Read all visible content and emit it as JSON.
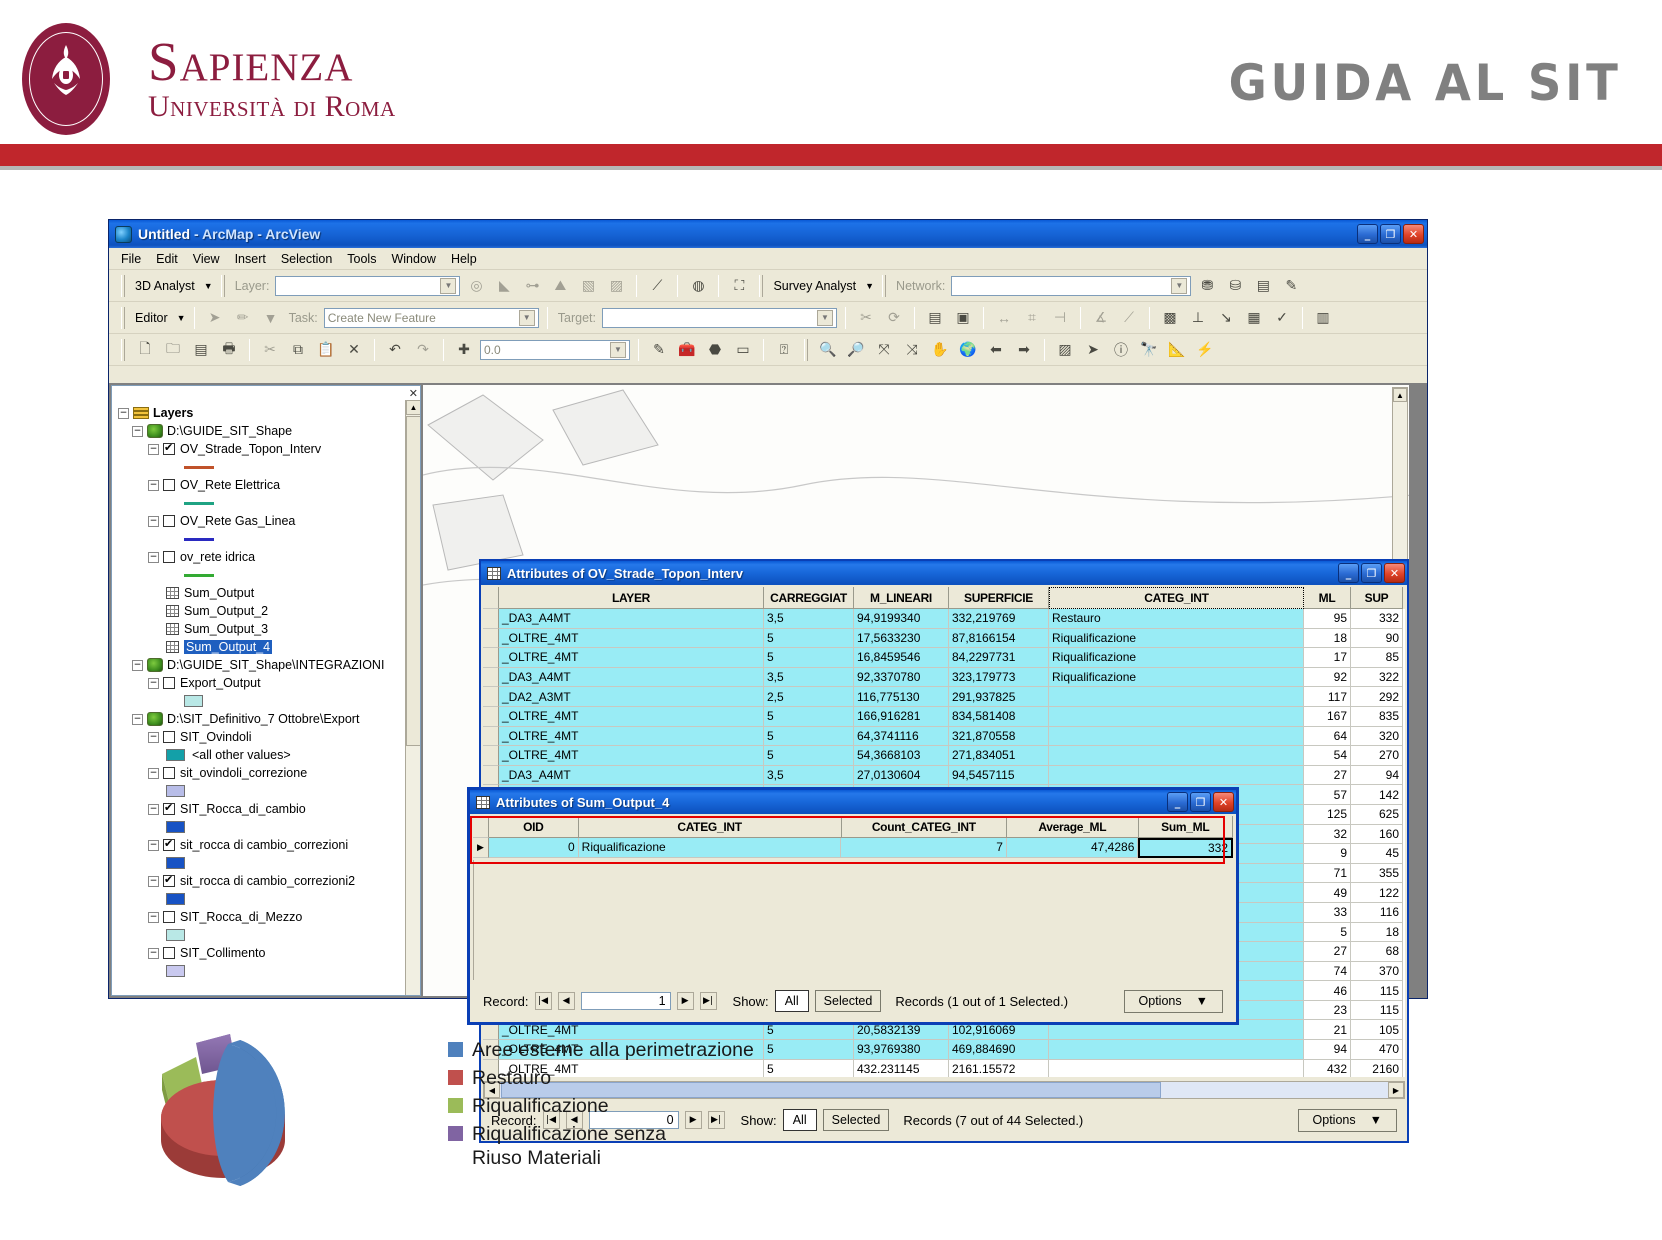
{
  "header": {
    "university_line1": "Sapienza",
    "university_line2": "Università di Roma",
    "title": "GUIDA AL SIT",
    "brand_color": "#8c1d3f",
    "bar_color": "#c0262c"
  },
  "arcmap": {
    "title": "Untitled",
    "title_suffix": " - ArcMap - ArcView",
    "window_buttons": {
      "minimize": "_",
      "maximize": "❐",
      "close": "✕"
    },
    "menu": [
      "File",
      "Edit",
      "View",
      "Insert",
      "Selection",
      "Tools",
      "Window",
      "Help"
    ],
    "toolbar_3d": {
      "dropdown_label": "3D Analyst",
      "layer_label": "Layer:",
      "layer_value": ""
    },
    "toolbar_survey": {
      "dropdown_label": "Survey Analyst",
      "network_label": "Network:",
      "network_value": ""
    },
    "toolbar_editor": {
      "dropdown_label": "Editor",
      "task_label": "Task:",
      "task_value": "Create New Feature",
      "target_label": "Target:",
      "target_value": ""
    },
    "toolbar_standard": {
      "scale_value": "0.0"
    }
  },
  "toc": {
    "root_label": "Layers",
    "groups": [
      {
        "path": "D:\\GUIDE_SIT_Shape",
        "layers": [
          {
            "name": "OV_Strade_Topon_Interv",
            "checked": true,
            "symbol_type": "line",
            "color": "#c0522a"
          },
          {
            "name": "OV_Rete Elettrica",
            "checked": false,
            "symbol_type": "line",
            "color": "#1fa383"
          },
          {
            "name": "OV_Rete Gas_Linea",
            "checked": false,
            "symbol_type": "line",
            "color": "#2a2ac0"
          },
          {
            "name": "ov_rete idrica",
            "checked": false,
            "symbol_type": "line",
            "color": "#33aa33"
          }
        ],
        "tables": [
          "Sum_Output",
          "Sum_Output_2",
          "Sum_Output_3",
          "Sum_Output_4"
        ],
        "selected_table": "Sum_Output_4"
      },
      {
        "path": "D:\\GUIDE_SIT_Shape\\INTEGRAZIONI",
        "layers": [
          {
            "name": "Export_Output",
            "checked": false,
            "symbol_type": "box",
            "color": "#b9e8e6"
          }
        ],
        "tables": [],
        "selected_table": null
      },
      {
        "path": "D:\\SIT_Definitivo_7 Ottobre\\Export",
        "layers": [
          {
            "name": "SIT_Ovindoli",
            "checked": false,
            "symbol_type": "box",
            "color": "#13a0a8",
            "sub_label": "<all other values>"
          },
          {
            "name": "sit_ovindoli_correzione",
            "checked": false,
            "symbol_type": "box",
            "color": "#b8bde8"
          },
          {
            "name": "SIT_Rocca_di_cambio",
            "checked": true,
            "symbol_type": "box",
            "color": "#1752c4"
          },
          {
            "name": "sit_rocca di cambio_correzioni",
            "checked": true,
            "symbol_type": "box",
            "color": "#1752c4"
          },
          {
            "name": "sit_rocca di cambio_correzioni2",
            "checked": true,
            "symbol_type": "box",
            "color": "#1752c4"
          },
          {
            "name": "SIT_Rocca_di_Mezzo",
            "checked": false,
            "symbol_type": "box",
            "color": "#b9e8e6"
          },
          {
            "name": "SIT_Collimento",
            "checked": false,
            "symbol_type": "box",
            "color": "#c9c9ef"
          }
        ],
        "tables": [],
        "selected_table": null
      }
    ]
  },
  "attr_table": {
    "title": "Attributes of OV_Strade_Topon_Interv",
    "columns": [
      "LAYER",
      "CARREGGIAT",
      "M_LINEARI",
      "SUPERFICIE",
      "CATEG_INT",
      "ML",
      "SUP"
    ],
    "focused_column": "CATEG_INT",
    "rows": [
      {
        "LAYER": "_DA3_A4MT",
        "CARREGGIAT": "3,5",
        "M_LINEARI": "94,9199340",
        "SUPERFICIE": "332,219769",
        "CATEG_INT": "Restauro",
        "ML": "95",
        "SUP": "332",
        "selected": true
      },
      {
        "LAYER": "_OLTRE_4MT",
        "CARREGGIAT": "5",
        "M_LINEARI": "17,5633230",
        "SUPERFICIE": "87,8166154",
        "CATEG_INT": "Riqualificazione",
        "ML": "18",
        "SUP": "90",
        "selected": true
      },
      {
        "LAYER": "_OLTRE_4MT",
        "CARREGGIAT": "5",
        "M_LINEARI": "16,8459546",
        "SUPERFICIE": "84,2297731",
        "CATEG_INT": "Riqualificazione",
        "ML": "17",
        "SUP": "85",
        "selected": true
      },
      {
        "LAYER": "_DA3_A4MT",
        "CARREGGIAT": "3,5",
        "M_LINEARI": "92,3370780",
        "SUPERFICIE": "323,179773",
        "CATEG_INT": "Riqualificazione",
        "ML": "92",
        "SUP": "322",
        "selected": true
      },
      {
        "LAYER": "_DA2_A3MT",
        "CARREGGIAT": "2,5",
        "M_LINEARI": "116,775130",
        "SUPERFICIE": "291,937825",
        "CATEG_INT": "",
        "ML": "117",
        "SUP": "292",
        "selected": true
      },
      {
        "LAYER": "_OLTRE_4MT",
        "CARREGGIAT": "5",
        "M_LINEARI": "166,916281",
        "SUPERFICIE": "834,581408",
        "CATEG_INT": "",
        "ML": "167",
        "SUP": "835",
        "selected": true
      },
      {
        "LAYER": "_OLTRE_4MT",
        "CARREGGIAT": "5",
        "M_LINEARI": "64,3741116",
        "SUPERFICIE": "321,870558",
        "CATEG_INT": "",
        "ML": "64",
        "SUP": "320",
        "selected": true
      },
      {
        "LAYER": "_OLTRE_4MT",
        "CARREGGIAT": "5",
        "M_LINEARI": "54,3668103",
        "SUPERFICIE": "271,834051",
        "CATEG_INT": "",
        "ML": "54",
        "SUP": "270",
        "selected": true
      },
      {
        "LAYER": "_DA3_A4MT",
        "CARREGGIAT": "3,5",
        "M_LINEARI": "27,0130604",
        "SUPERFICIE": "94,5457115",
        "CATEG_INT": "",
        "ML": "27",
        "SUP": "94",
        "selected": true
      },
      {
        "LAYER": "",
        "CARREGGIAT": "",
        "M_LINEARI": "",
        "SUPERFICIE": "",
        "CATEG_INT": "",
        "ML": "57",
        "SUP": "142",
        "selected": true
      },
      {
        "LAYER": "",
        "CARREGGIAT": "",
        "M_LINEARI": "",
        "SUPERFICIE": "",
        "CATEG_INT": "",
        "ML": "125",
        "SUP": "625",
        "selected": true
      },
      {
        "LAYER": "",
        "CARREGGIAT": "",
        "M_LINEARI": "",
        "SUPERFICIE": "",
        "CATEG_INT": "",
        "ML": "32",
        "SUP": "160",
        "selected": true
      },
      {
        "LAYER": "",
        "CARREGGIAT": "",
        "M_LINEARI": "",
        "SUPERFICIE": "",
        "CATEG_INT": "",
        "ML": "9",
        "SUP": "45",
        "selected": true
      },
      {
        "LAYER": "",
        "CARREGGIAT": "",
        "M_LINEARI": "",
        "SUPERFICIE": "",
        "CATEG_INT": "",
        "ML": "71",
        "SUP": "355",
        "selected": true
      },
      {
        "LAYER": "",
        "CARREGGIAT": "",
        "M_LINEARI": "",
        "SUPERFICIE": "",
        "CATEG_INT": "",
        "ML": "49",
        "SUP": "122",
        "selected": true
      },
      {
        "LAYER": "",
        "CARREGGIAT": "",
        "M_LINEARI": "",
        "SUPERFICIE": "",
        "CATEG_INT": "",
        "ML": "33",
        "SUP": "116",
        "selected": true
      },
      {
        "LAYER": "",
        "CARREGGIAT": "",
        "M_LINEARI": "",
        "SUPERFICIE": "",
        "CATEG_INT": "",
        "ML": "5",
        "SUP": "18",
        "selected": true
      },
      {
        "LAYER": "",
        "CARREGGIAT": "",
        "M_LINEARI": "",
        "SUPERFICIE": "",
        "CATEG_INT": "",
        "ML": "27",
        "SUP": "68",
        "selected": true
      },
      {
        "LAYER": "",
        "CARREGGIAT": "",
        "M_LINEARI": "",
        "SUPERFICIE": "",
        "CATEG_INT": "",
        "ML": "74",
        "SUP": "370",
        "selected": true
      },
      {
        "LAYER": "",
        "CARREGGIAT": "",
        "M_LINEARI": "",
        "SUPERFICIE": "",
        "CATEG_INT": "",
        "ML": "46",
        "SUP": "115",
        "selected": true
      },
      {
        "LAYER": "",
        "CARREGGIAT": "",
        "M_LINEARI": "",
        "SUPERFICIE": "",
        "CATEG_INT": "",
        "ML": "23",
        "SUP": "115",
        "selected": true
      },
      {
        "LAYER": "_OLTRE_4MT",
        "CARREGGIAT": "5",
        "M_LINEARI": "20,5832139",
        "SUPERFICIE": "102,916069",
        "CATEG_INT": "",
        "ML": "21",
        "SUP": "105",
        "selected": true
      },
      {
        "LAYER": "_OLTRE_4MT",
        "CARREGGIAT": "5",
        "M_LINEARI": "93,9769380",
        "SUPERFICIE": "469,884690",
        "CATEG_INT": "",
        "ML": "94",
        "SUP": "470",
        "selected": true
      },
      {
        "LAYER": "_OLTRE_4MT",
        "CARREGGIAT": "5",
        "M_LINEARI": "432.231145",
        "SUPERFICIE": "2161.15572",
        "CATEG_INT": "",
        "ML": "432",
        "SUP": "2160",
        "selected": false
      }
    ],
    "record_bar": {
      "record_label": "Record:",
      "record_value": "0",
      "show_label": "Show:",
      "show_all": "All",
      "show_selected": "Selected",
      "records_text": "Records  (7 out of 44 Selected.)",
      "options_label": "Options"
    }
  },
  "sum_window": {
    "title": "Attributes of Sum_Output_4",
    "columns": [
      "OID",
      "CATEG_INT",
      "Count_CATEG_INT",
      "Average_ML",
      "Sum_ML"
    ],
    "rows": [
      {
        "OID": "0",
        "CATEG_INT": "Riqualificazione",
        "Count_CATEG_INT": "7",
        "Average_ML": "47,4286",
        "Sum_ML": "332",
        "selected": true
      }
    ],
    "highlight_color": "#e50000",
    "record_bar": {
      "record_label": "Record:",
      "record_value": "1",
      "show_label": "Show:",
      "show_all": "All",
      "show_selected": "Selected",
      "records_text": "Records  (1 out of 1 Selected.)",
      "options_label": "Options"
    }
  },
  "chart_data": {
    "type": "pie",
    "title": "",
    "legend_position": "right",
    "categories": [
      "Aree esterne alla perimetrazione",
      "Restauro",
      "Riqualificazione",
      "Riqualificazione senza Riuso Materiali"
    ],
    "colors": [
      "#4f81bd",
      "#c0504d",
      "#9bbb59",
      "#8064a2"
    ],
    "values": [
      52,
      26,
      12,
      10
    ]
  },
  "legend": {
    "items": [
      {
        "label": "Aree esterne alla perimetrazione",
        "color": "#4f81bd"
      },
      {
        "label": "Restauro",
        "color": "#c0504d"
      },
      {
        "label": "Riqualificazione",
        "color": "#9bbb59"
      },
      {
        "label": "Riqualificazione senza",
        "label2": "Riuso Materiali",
        "color": "#8064a2"
      }
    ]
  }
}
